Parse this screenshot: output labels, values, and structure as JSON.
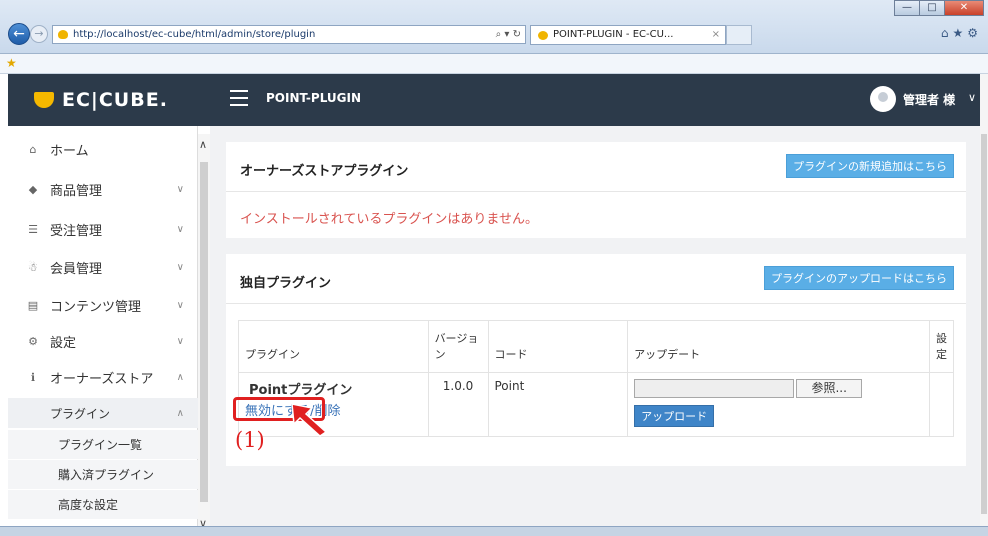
{
  "browser": {
    "url": "http://localhost/ec-cube/html/admin/store/plugin",
    "address_tools": "⌕ ▾ ↻",
    "tab_title": "POINT-PLUGIN - EC-CU...",
    "tab_close": "×",
    "window_controls": [
      "—",
      "□",
      "✕"
    ],
    "toolbar_icons": "⌂★⚙"
  },
  "header": {
    "logo_text": "EC|CUBE.",
    "page_title": "POINT-PLUGIN",
    "user_name": "管理者 様",
    "user_chevron": "∨"
  },
  "sidebar": {
    "items": [
      {
        "label": "ホーム",
        "icon": "⌂",
        "chev": "∧"
      },
      {
        "label": "商品管理",
        "icon": "◆",
        "chev": "∨"
      },
      {
        "label": "受注管理",
        "icon": "☰",
        "chev": "∨"
      },
      {
        "label": "会員管理",
        "icon": "☃",
        "chev": "∨"
      },
      {
        "label": "コンテンツ管理",
        "icon": "▤",
        "chev": "∨"
      },
      {
        "label": "設定",
        "icon": "⚙",
        "chev": "∨"
      },
      {
        "label": "オーナーズストア",
        "icon": "ℹ",
        "chev": "∧"
      }
    ],
    "sub_plugin": {
      "label": "プラグイン",
      "chev": "∧"
    },
    "subsub": [
      "プラグイン一覧",
      "購入済プラグイン",
      "高度な設定"
    ],
    "scroll_up": "∧",
    "scroll_down": "∨"
  },
  "owner_store_panel": {
    "title": "オーナーズストアプラグイン",
    "add_button": "プラグインの新規追加はこちら",
    "empty_message": "インストールされているプラグインはありません。"
  },
  "custom_panel": {
    "title": "独自プラグイン",
    "upload_button": "プラグインのアップロードはこちら",
    "columns": [
      "プラグイン",
      "バージョン",
      "コード",
      "アップデート",
      "設定"
    ],
    "rows": [
      {
        "name": "Pointプラグイン",
        "disable_link": "無効にする",
        "separator": "/",
        "delete_link": "削除",
        "version": "1.0.0",
        "code": "Point",
        "browse_label": "参照...",
        "upload_label": "アップロード"
      }
    ]
  },
  "annotation": {
    "label": "(1)",
    "color": "#e02020"
  },
  "colors": {
    "header_bg": "#2c3a4a",
    "accent": "#5aaee6",
    "logo": "#f5b800",
    "error_text": "#d9534f",
    "link": "#3a73b8"
  }
}
